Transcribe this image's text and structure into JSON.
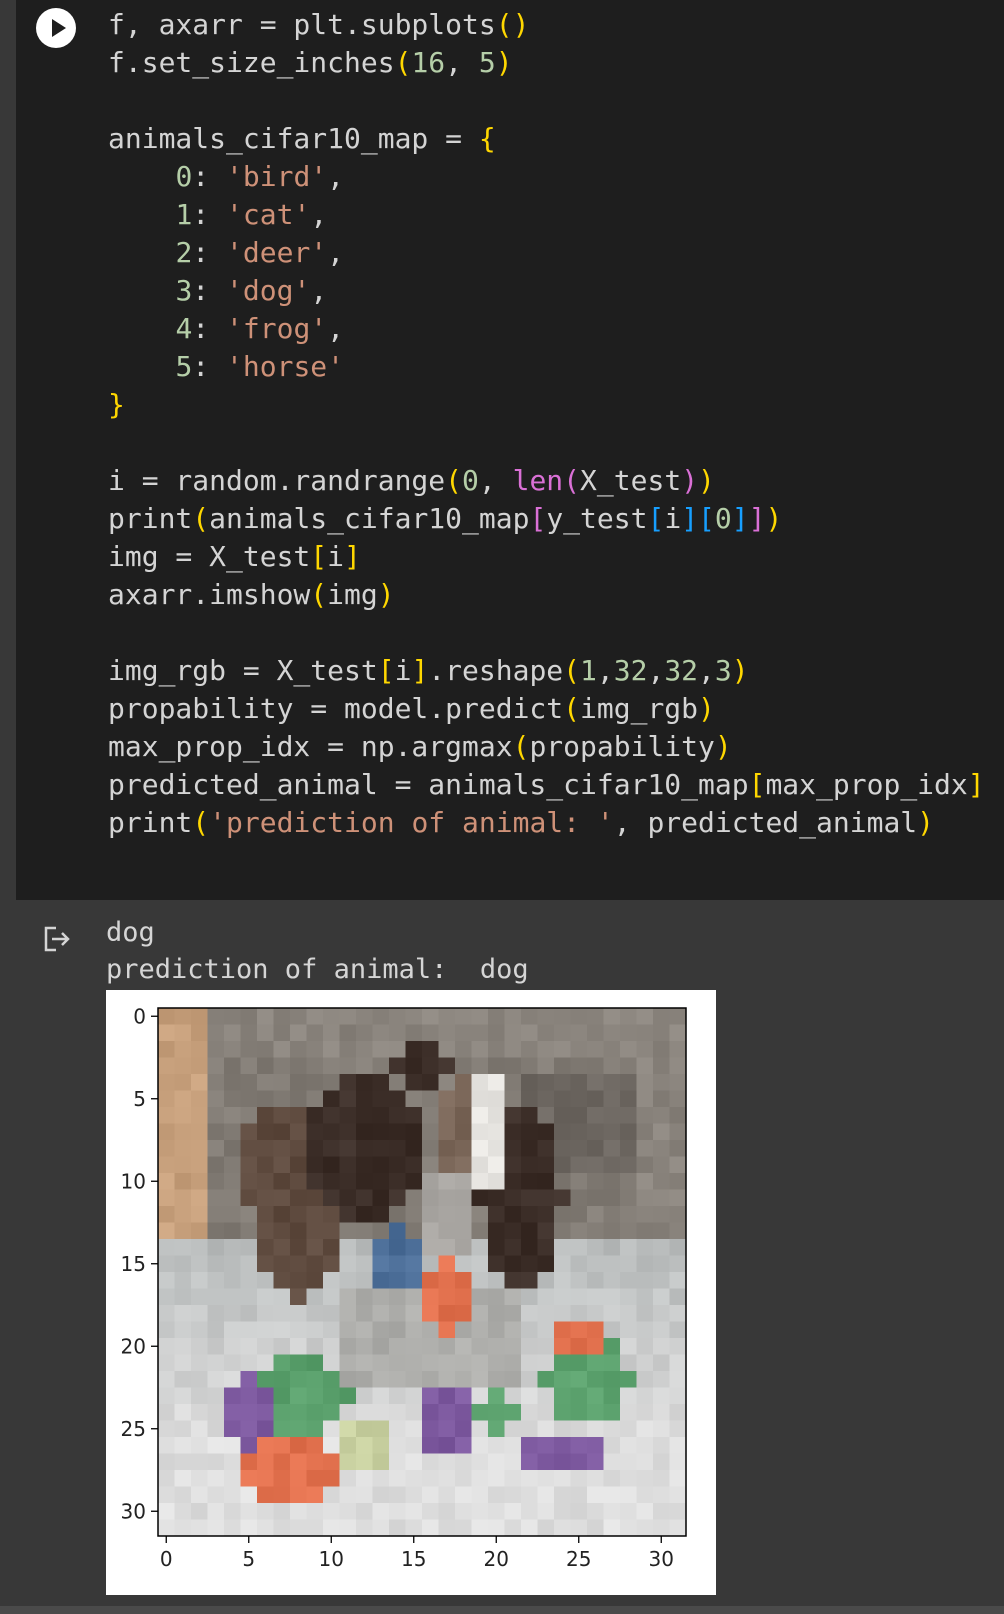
{
  "code_cell": {
    "run_button_icon": "play-icon",
    "lines": [
      [
        [
          "f, axarr = plt.subplots",
          ""
        ],
        [
          "(",
          "br1"
        ],
        [
          ")",
          "br1"
        ]
      ],
      [
        [
          "f.set_size_inches",
          ""
        ],
        [
          "(",
          "br1"
        ],
        [
          "16",
          "num"
        ],
        [
          ", ",
          ""
        ],
        [
          "5",
          "num"
        ],
        [
          ")",
          "br1"
        ]
      ],
      [
        [
          "",
          ""
        ]
      ],
      [
        [
          "animals_cifar10_map = ",
          ""
        ],
        [
          "{",
          "br1"
        ]
      ],
      [
        [
          "    ",
          ""
        ],
        [
          "0",
          "num"
        ],
        [
          ": ",
          ""
        ],
        [
          "'bird'",
          "str"
        ],
        [
          ",",
          ""
        ]
      ],
      [
        [
          "    ",
          ""
        ],
        [
          "1",
          "num"
        ],
        [
          ": ",
          ""
        ],
        [
          "'cat'",
          "str"
        ],
        [
          ",",
          ""
        ]
      ],
      [
        [
          "    ",
          ""
        ],
        [
          "2",
          "num"
        ],
        [
          ": ",
          ""
        ],
        [
          "'deer'",
          "str"
        ],
        [
          ",",
          ""
        ]
      ],
      [
        [
          "    ",
          ""
        ],
        [
          "3",
          "num"
        ],
        [
          ": ",
          ""
        ],
        [
          "'dog'",
          "str"
        ],
        [
          ",",
          ""
        ]
      ],
      [
        [
          "    ",
          ""
        ],
        [
          "4",
          "num"
        ],
        [
          ": ",
          ""
        ],
        [
          "'frog'",
          "str"
        ],
        [
          ",",
          ""
        ]
      ],
      [
        [
          "    ",
          ""
        ],
        [
          "5",
          "num"
        ],
        [
          ": ",
          ""
        ],
        [
          "'horse'",
          "str"
        ]
      ],
      [
        [
          "}",
          "br1"
        ]
      ],
      [
        [
          "",
          ""
        ]
      ],
      [
        [
          "i = random.randrange",
          ""
        ],
        [
          "(",
          "br1"
        ],
        [
          "0",
          "num"
        ],
        [
          ", ",
          ""
        ],
        [
          "len",
          "br2"
        ],
        [
          "(",
          "br2"
        ],
        [
          "X_test",
          ""
        ],
        [
          ")",
          "br2"
        ],
        [
          ")",
          "br1"
        ]
      ],
      [
        [
          "print",
          ""
        ],
        [
          "(",
          "br1"
        ],
        [
          "animals_cifar10_map",
          ""
        ],
        [
          "[",
          "br2"
        ],
        [
          "y_test",
          ""
        ],
        [
          "[",
          "br3"
        ],
        [
          "i",
          ""
        ],
        [
          "]",
          "br3"
        ],
        [
          "[",
          "br3"
        ],
        [
          "0",
          "num"
        ],
        [
          "]",
          "br3"
        ],
        [
          "]",
          "br2"
        ],
        [
          ")",
          "br1"
        ]
      ],
      [
        [
          "img = X_test",
          ""
        ],
        [
          "[",
          "br1"
        ],
        [
          "i",
          ""
        ],
        [
          "]",
          "br1"
        ]
      ],
      [
        [
          "axarr.imshow",
          ""
        ],
        [
          "(",
          "br1"
        ],
        [
          "img",
          ""
        ],
        [
          ")",
          "br1"
        ]
      ],
      [
        [
          "",
          ""
        ]
      ],
      [
        [
          "img_rgb = X_test",
          ""
        ],
        [
          "[",
          "br1"
        ],
        [
          "i",
          ""
        ],
        [
          "]",
          "br1"
        ],
        [
          ".reshape",
          ""
        ],
        [
          "(",
          "br1"
        ],
        [
          "1",
          "num"
        ],
        [
          ",",
          ""
        ],
        [
          "32",
          "num"
        ],
        [
          ",",
          ""
        ],
        [
          "32",
          "num"
        ],
        [
          ",",
          ""
        ],
        [
          "3",
          "num"
        ],
        [
          ")",
          "br1"
        ]
      ],
      [
        [
          "propability = model.predict",
          ""
        ],
        [
          "(",
          "br1"
        ],
        [
          "img_rgb",
          ""
        ],
        [
          ")",
          "br1"
        ]
      ],
      [
        [
          "max_prop_idx = np.argmax",
          ""
        ],
        [
          "(",
          "br1"
        ],
        [
          "propability",
          ""
        ],
        [
          ")",
          "br1"
        ]
      ],
      [
        [
          "predicted_animal = animals_cifar10_map",
          ""
        ],
        [
          "[",
          "br1"
        ],
        [
          "max_prop_idx",
          ""
        ],
        [
          "]",
          "br1"
        ]
      ],
      [
        [
          "print",
          ""
        ],
        [
          "(",
          "br1"
        ],
        [
          "'prediction of animal: '",
          "str"
        ],
        [
          ", predicted_animal",
          ""
        ],
        [
          ")",
          "br1"
        ]
      ]
    ]
  },
  "output": {
    "icon": "output-arrow-icon",
    "lines": [
      "dog",
      "prediction of animal:  dog"
    ]
  },
  "chart_data": {
    "type": "heatmap",
    "title": "",
    "xlabel": "",
    "ylabel": "",
    "xlim": [
      -0.5,
      31.5
    ],
    "ylim": [
      31.5,
      -0.5
    ],
    "x_ticks": [
      0,
      5,
      10,
      15,
      20,
      25,
      30
    ],
    "y_ticks": [
      0,
      5,
      10,
      15,
      20,
      25,
      30
    ],
    "grid": false,
    "image_size": [
      32,
      32
    ],
    "image_content": "pixelated CIFAR-10 test image of a dog",
    "colors": {
      "bg_wall": "#8a847d",
      "bg_wall_dark": "#6e6862",
      "tan": "#c7a07c",
      "dark_brown": "#3c2e28",
      "brown": "#5e4a3e",
      "mid_brown": "#7a6658",
      "white_fur": "#e8e6e2",
      "gray_fur": "#a7a4a0",
      "floor_light": "#dedede",
      "floor_gray": "#b9bcbc",
      "purple": "#7e5aa0",
      "green": "#5aa06c",
      "orange": "#e2714e",
      "blue": "#4c6e98",
      "lime": "#c8d0a0"
    }
  }
}
